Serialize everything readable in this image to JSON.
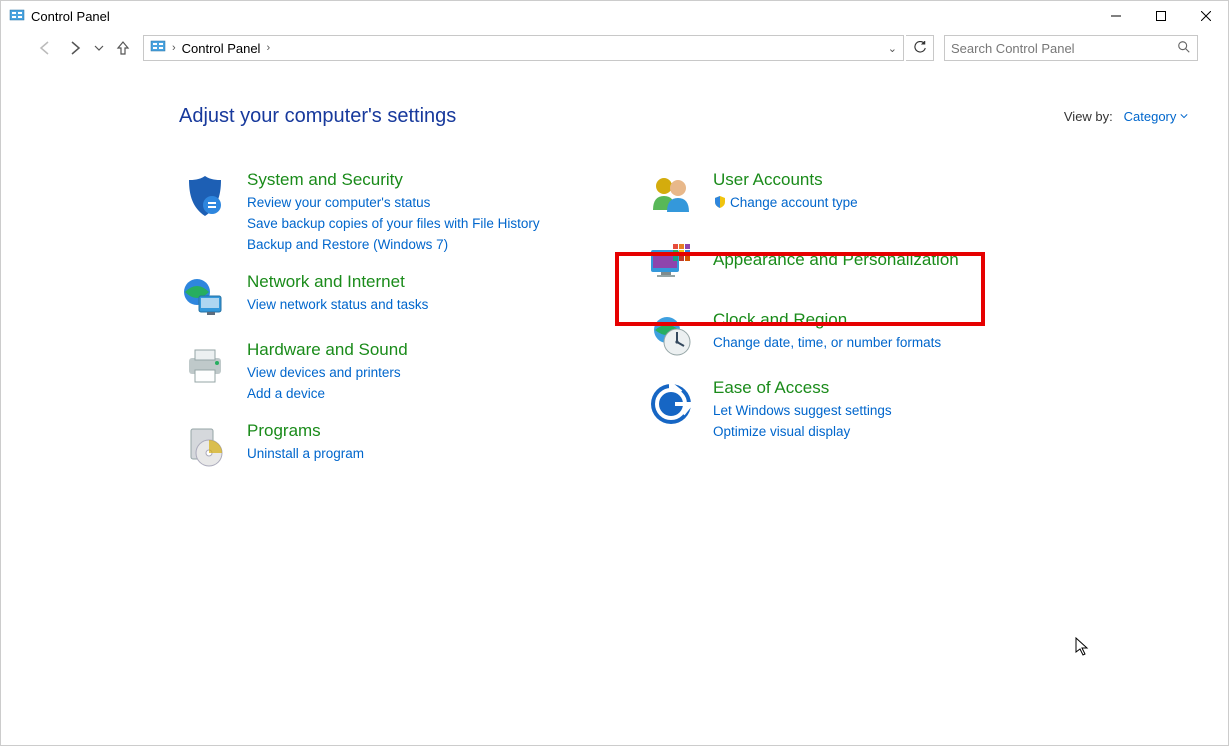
{
  "window": {
    "title": "Control Panel"
  },
  "address": {
    "location": "Control Panel"
  },
  "search": {
    "placeholder": "Search Control Panel"
  },
  "header": {
    "title": "Adjust your computer's settings",
    "view_by_label": "View by:",
    "view_by_value": "Category"
  },
  "left": [
    {
      "title": "System and Security",
      "links": [
        "Review your computer's status",
        "Save backup copies of your files with File History",
        "Backup and Restore (Windows 7)"
      ]
    },
    {
      "title": "Network and Internet",
      "links": [
        "View network status and tasks"
      ]
    },
    {
      "title": "Hardware and Sound",
      "links": [
        "View devices and printers",
        "Add a device"
      ]
    },
    {
      "title": "Programs",
      "links": [
        "Uninstall a program"
      ]
    }
  ],
  "right": [
    {
      "title": "User Accounts",
      "links": [
        "Change account type"
      ],
      "shields": [
        true
      ]
    },
    {
      "title": "Appearance and Personalization",
      "links": []
    },
    {
      "title": "Clock and Region",
      "links": [
        "Change date, time, or number formats"
      ]
    },
    {
      "title": "Ease of Access",
      "links": [
        "Let Windows suggest settings",
        "Optimize visual display"
      ]
    }
  ]
}
